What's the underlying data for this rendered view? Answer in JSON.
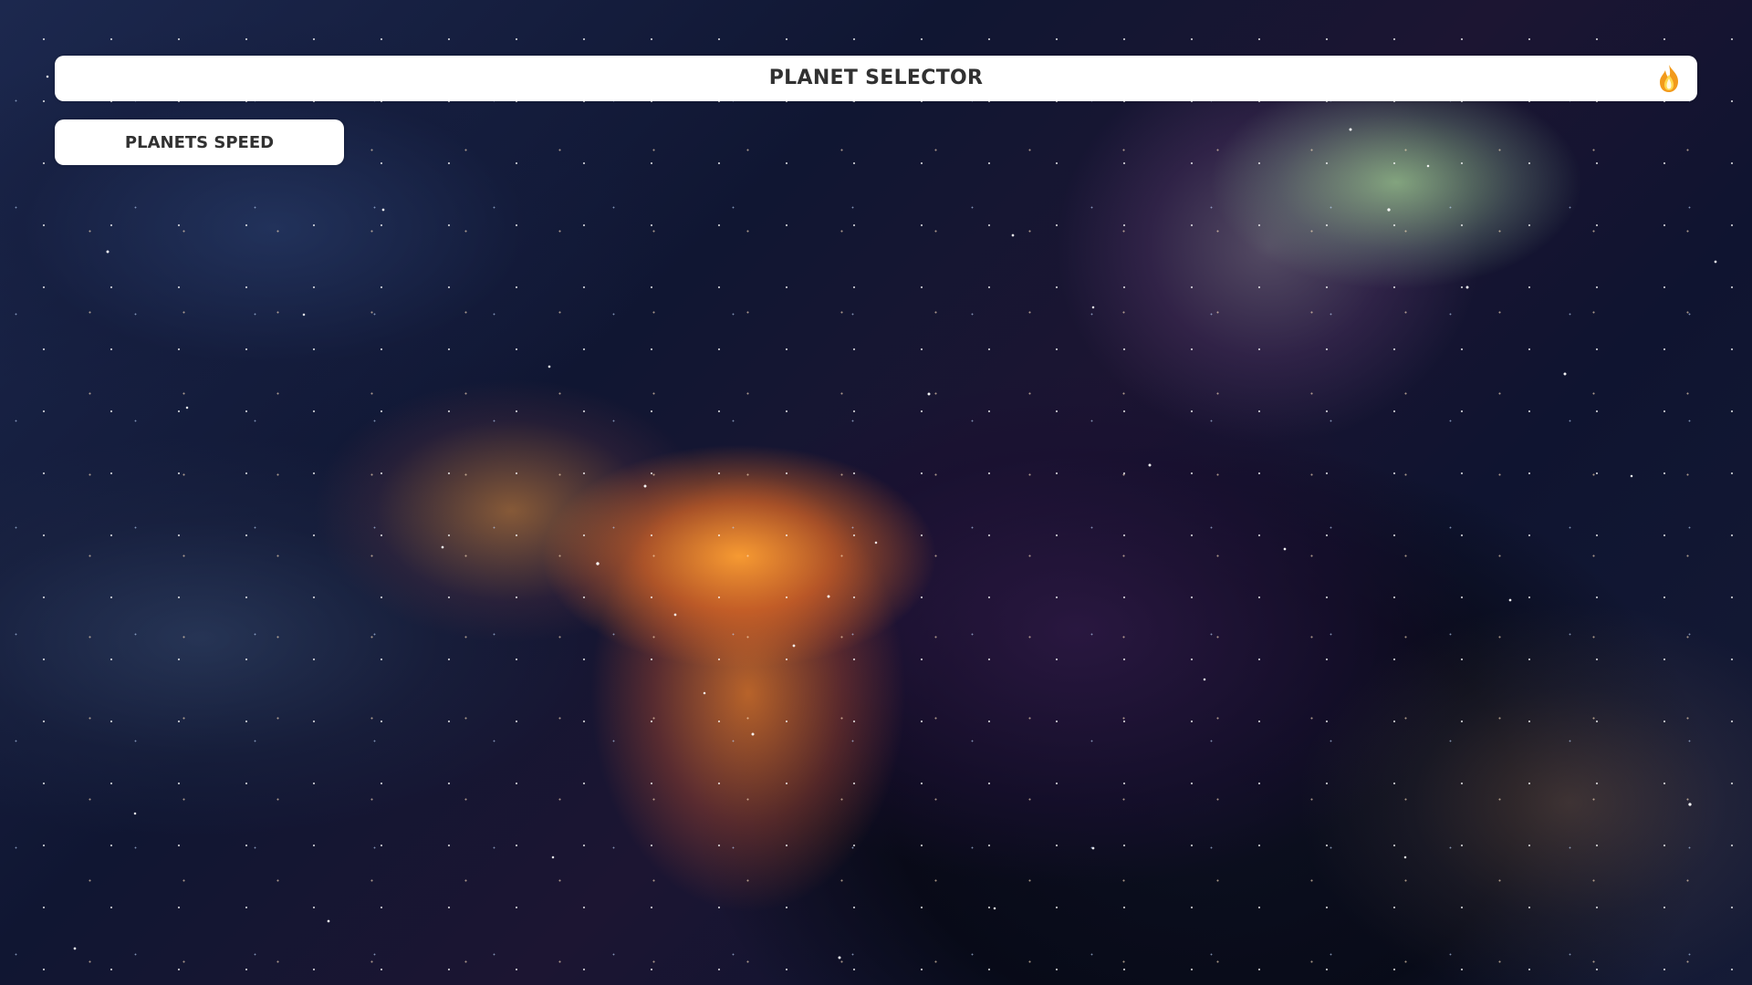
{
  "app": {
    "title": "PLANET SELECTOR"
  },
  "header": {
    "brand_icon": "flame-icon",
    "brand_color": "#F29A1B"
  },
  "controls": {
    "planets_speed_label": "PLANETS SPEED"
  },
  "background": {
    "theme": "space-nebula",
    "colors": [
      "#1C284E",
      "#F5822A",
      "#A5D796",
      "#301A48"
    ]
  }
}
